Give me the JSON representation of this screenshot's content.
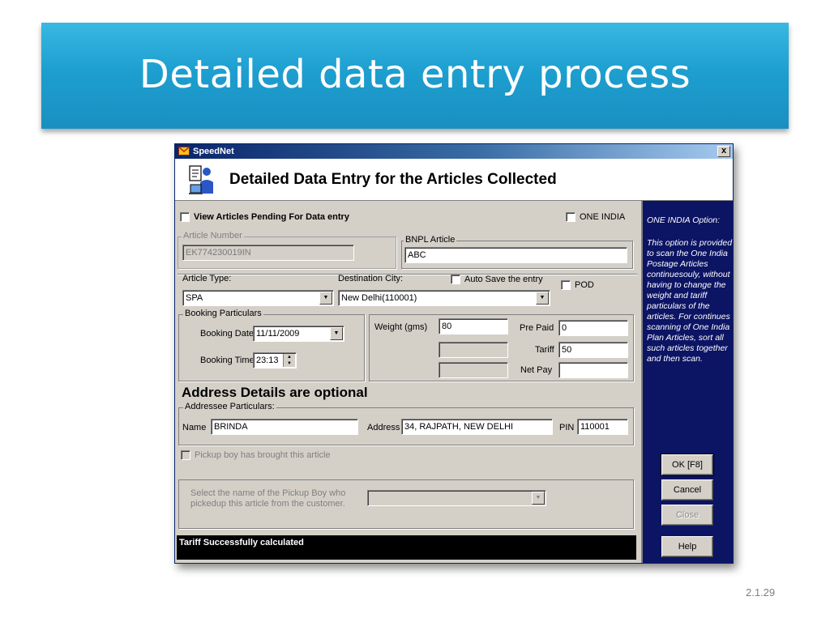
{
  "slide": {
    "title": "Detailed data entry process",
    "number": "2.1.29"
  },
  "window": {
    "title": "SpeedNet",
    "close_label": "x",
    "header_title": "Detailed Data Entry for the Articles Collected"
  },
  "form": {
    "view_pending_label": "View Articles Pending For Data entry",
    "one_india_label": "ONE INDIA",
    "article_number_label": "Article Number",
    "article_number_value": "EK774230019IN",
    "bnpl_label": "BNPL Article",
    "bnpl_value": "ABC",
    "article_type_label": "Article Type:",
    "article_type_value": "SPA",
    "destination_label": "Destination City:",
    "destination_value": "New Delhi(110001)",
    "auto_save_label": "Auto Save the entry",
    "pod_label": "POD",
    "booking_group_label": "Booking Particulars",
    "booking_date_label": "Booking Date",
    "booking_date_value": "11/11/2009",
    "booking_time_label": "Booking Time",
    "booking_time_value": "23:13",
    "weight_label": "Weight (gms)",
    "weight_value": "80",
    "prepaid_label": "Pre Paid",
    "prepaid_value": "0",
    "tariff_label": "Tariff",
    "tariff_value": "50",
    "netpay_label": "Net Pay",
    "netpay_value": "",
    "address_heading": "Address Details are optional",
    "addressee_group_label": "Addressee Particulars:",
    "name_label": "Name",
    "name_value": "BRINDA",
    "address_label": "Address",
    "address_value": "34, RAJPATH, NEW DELHI",
    "pin_label": "PIN",
    "pin_value": "110001",
    "pickup_label": "Pickup boy has brought this article",
    "pickup_select_label": "Select the name of the Pickup Boy who pickedup this article from the customer.",
    "pickup_select_value": ""
  },
  "status": {
    "message": "Tariff Successfully calculated"
  },
  "panel": {
    "title": "ONE INDIA Option:",
    "text": "This option is provided to scan the One India Postage Articles continuesouly, without having to change the weight and tariff particulars of the articles. For continues scanning of One India Plan Articles, sort all such articles together and then scan."
  },
  "buttons": {
    "ok": "OK [F8]",
    "cancel": "Cancel",
    "close": "Close",
    "help": "Help"
  },
  "colors": {
    "banner": "#1d9fd0",
    "panel": "#0c1464",
    "titlebar": "#0a246a",
    "face": "#d4d0c8"
  }
}
